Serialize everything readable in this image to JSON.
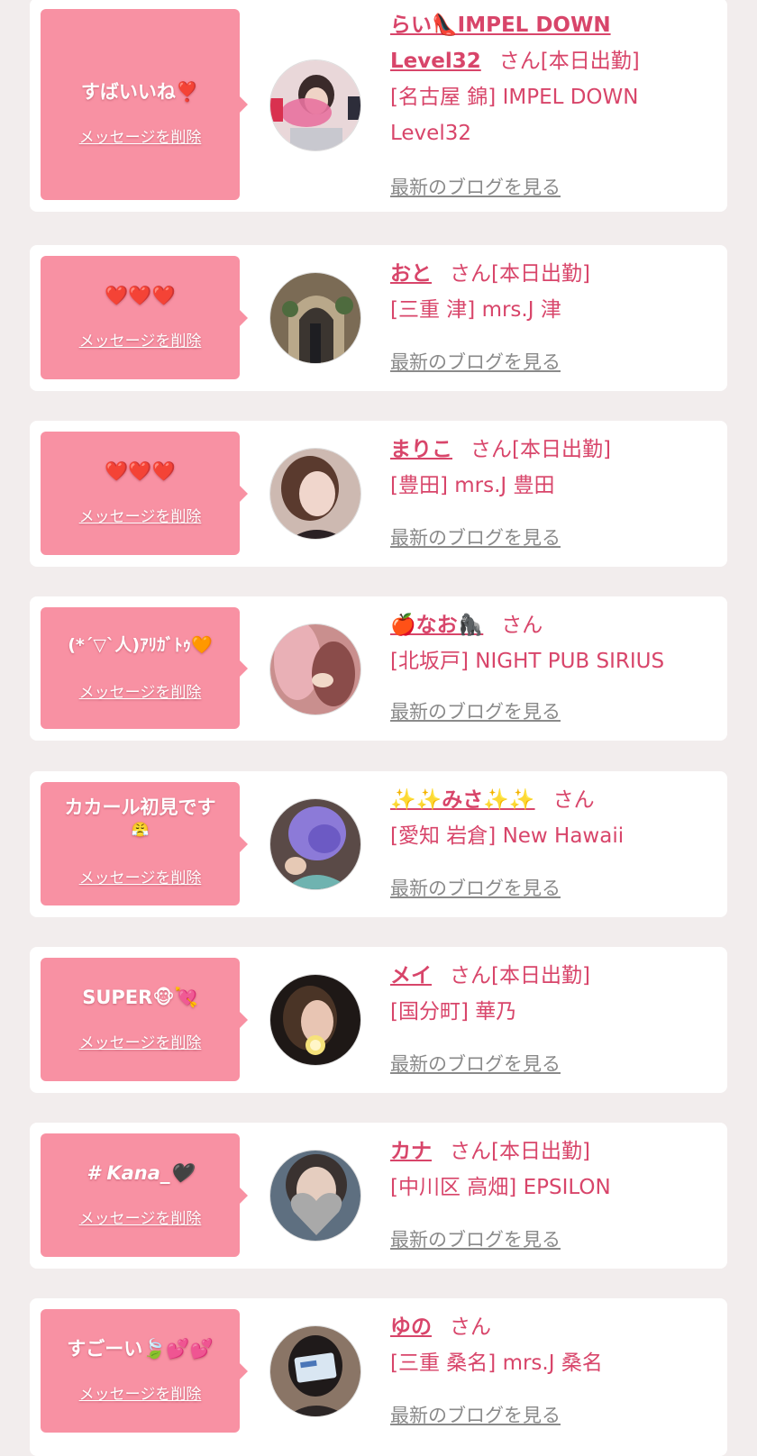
{
  "delete_label": "メッセージを削除",
  "blog_label": "最新のブログを見る",
  "colors": {
    "background": "#f2eded",
    "bubble": "#f891a3",
    "accent": "#d8456a",
    "link_gray": "#8a8a8a"
  },
  "items": [
    {
      "message": "すばいいね❣️",
      "cast_name_1": "らい👠IMPEL DOWN",
      "cast_name_2": "Level32",
      "san": "さん[本日出勤]",
      "shop_1": "[名古屋 錦] IMPEL DOWN",
      "shop_2": "Level32",
      "avatar_icon": "avatar-pink-sign"
    },
    {
      "message": "❤️❤️❤️",
      "cast_name_1": "おと",
      "san": "さん[本日出勤]",
      "shop_1": "[三重 津] mrs.J 津",
      "avatar_icon": "avatar-doorway"
    },
    {
      "message": "❤️❤️❤️",
      "cast_name_1": "まりこ",
      "san": "さん[本日出勤]",
      "shop_1": "[豊田] mrs.J 豊田",
      "avatar_icon": "avatar-portrait"
    },
    {
      "message": "(*´▽`人)ｱﾘｶﾞﾄｩ🧡",
      "cast_name_1": "🍎なお🦍",
      "san": "さん",
      "shop_1": "[北坂戸] NIGHT PUB SIRIUS",
      "avatar_icon": "avatar-pink-blur"
    },
    {
      "message": "カカール初見です",
      "message_2": "😤",
      "cast_name_1": "✨✨みさ✨✨",
      "san": "さん",
      "shop_1": "[愛知 岩倉] New Hawaii",
      "avatar_icon": "avatar-purple-hair"
    },
    {
      "message": "SUPER🐵💘",
      "cast_name_1": "メイ",
      "san": "さん[本日出勤]",
      "shop_1": "[国分町] 華乃",
      "avatar_icon": "avatar-dark-portrait"
    },
    {
      "message": "# Kana_🖤",
      "cast_name_1": "カナ",
      "san": "さん[本日出勤]",
      "shop_1": "[中川区 高畑] EPSILON",
      "avatar_icon": "avatar-heart-sticker"
    },
    {
      "message": "すごーい🍃💕💕",
      "cast_name_1": "ゆの",
      "san": "さん",
      "shop_1": "[三重 桑名] mrs.J 桑名",
      "avatar_icon": "avatar-card-cover"
    }
  ]
}
